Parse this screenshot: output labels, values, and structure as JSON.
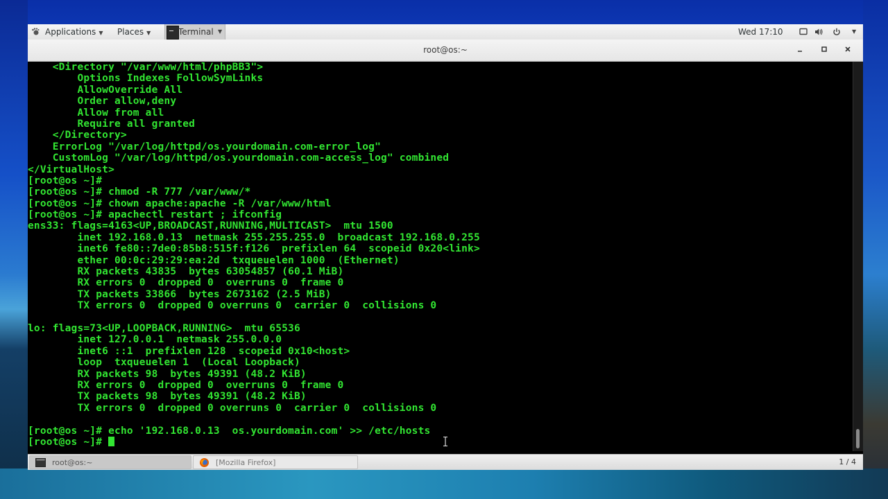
{
  "top_panel": {
    "applications": "Applications",
    "places": "Places",
    "terminal": "Terminal",
    "clock": "Wed 17:10"
  },
  "window": {
    "title": "root@os:~"
  },
  "terminal_lines": [
    "    <Directory \"/var/www/html/phpBB3\">",
    "        Options Indexes FollowSymLinks",
    "        AllowOverride All",
    "        Order allow,deny",
    "        Allow from all",
    "        Require all granted",
    "    </Directory>",
    "    ErrorLog \"/var/log/httpd/os.yourdomain.com-error_log\"",
    "    CustomLog \"/var/log/httpd/os.yourdomain.com-access_log\" combined",
    "</VirtualHost>",
    "[root@os ~]#",
    "[root@os ~]# chmod -R 777 /var/www/*",
    "[root@os ~]# chown apache:apache -R /var/www/html",
    "[root@os ~]# apachectl restart ; ifconfig",
    "ens33: flags=4163<UP,BROADCAST,RUNNING,MULTICAST>  mtu 1500",
    "        inet 192.168.0.13  netmask 255.255.255.0  broadcast 192.168.0.255",
    "        inet6 fe80::7de0:85b8:515f:f126  prefixlen 64  scopeid 0x20<link>",
    "        ether 00:0c:29:29:ea:2d  txqueuelen 1000  (Ethernet)",
    "        RX packets 43835  bytes 63054857 (60.1 MiB)",
    "        RX errors 0  dropped 0  overruns 0  frame 0",
    "        TX packets 33866  bytes 2673162 (2.5 MiB)",
    "        TX errors 0  dropped 0 overruns 0  carrier 0  collisions 0",
    "",
    "lo: flags=73<UP,LOOPBACK,RUNNING>  mtu 65536",
    "        inet 127.0.0.1  netmask 255.0.0.0",
    "        inet6 ::1  prefixlen 128  scopeid 0x10<host>",
    "        loop  txqueuelen 1  (Local Loopback)",
    "        RX packets 98  bytes 49391 (48.2 KiB)",
    "        RX errors 0  dropped 0  overruns 0  frame 0",
    "        TX packets 98  bytes 49391 (48.2 KiB)",
    "        TX errors 0  dropped 0 overruns 0  carrier 0  collisions 0",
    "",
    "[root@os ~]# echo '192.168.0.13  os.yourdomain.com' >> /etc/hosts"
  ],
  "prompt": "[root@os ~]# ",
  "taskbar": {
    "tasks": [
      {
        "label": "root@os:~"
      },
      {
        "label": "[Mozilla Firefox]"
      }
    ],
    "workspace": "1 / 4"
  },
  "colors": {
    "terminal_text": "#32e632",
    "terminal_bg": "#000000"
  }
}
